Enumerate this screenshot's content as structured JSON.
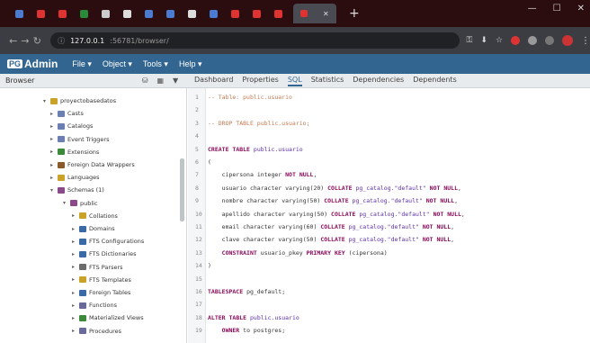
{
  "browser": {
    "address": "127.0.0.1",
    "address_path": ":56781/browser/"
  },
  "app": {
    "logo_prefix": "PG",
    "logo_text": "Admin",
    "menu": [
      "File ▾",
      "Object ▾",
      "Tools ▾",
      "Help ▾"
    ]
  },
  "panel": {
    "browser_label": "Browser",
    "tabs": [
      "Dashboard",
      "Properties",
      "SQL",
      "Statistics",
      "Dependencies",
      "Dependents"
    ],
    "active_tab": "SQL"
  },
  "tree": [
    {
      "label": "proyectobasedatos",
      "color": "#c9a227",
      "arrow": "▾"
    },
    {
      "label": "Casts",
      "color": "#6b7fb3",
      "arrow": "▸"
    },
    {
      "label": "Catalogs",
      "color": "#6b7fb3",
      "arrow": "▸"
    },
    {
      "label": "Event Triggers",
      "color": "#6b7fb3",
      "arrow": "▸"
    },
    {
      "label": "Extensions",
      "color": "#3a8a3a",
      "arrow": "▸"
    },
    {
      "label": "Foreign Data Wrappers",
      "color": "#8a5a2a",
      "arrow": "▸"
    },
    {
      "label": "Languages",
      "color": "#c9a227",
      "arrow": "▸"
    },
    {
      "label": "Schemas (1)",
      "color": "#8a4a8a",
      "arrow": "▾"
    },
    {
      "label": "public",
      "color": "#8a4a8a",
      "arrow": "▾"
    },
    {
      "label": "Collations",
      "color": "#c9a227",
      "arrow": "▸"
    },
    {
      "label": "Domains",
      "color": "#3a6aa6",
      "arrow": "▸"
    },
    {
      "label": "FTS Configurations",
      "color": "#3a6aa6",
      "arrow": "▸"
    },
    {
      "label": "FTS Dictionaries",
      "color": "#3a6aa6",
      "arrow": "▸"
    },
    {
      "label": "FTS Parsers",
      "color": "#6a6a6a",
      "arrow": "▸"
    },
    {
      "label": "FTS Templates",
      "color": "#c9a227",
      "arrow": "▸"
    },
    {
      "label": "Foreign Tables",
      "color": "#3a6aa6",
      "arrow": "▸"
    },
    {
      "label": "Functions",
      "color": "#6a6a9a",
      "arrow": "▸"
    },
    {
      "label": "Materialized Views",
      "color": "#3a8a3a",
      "arrow": "▸"
    },
    {
      "label": "Procedures",
      "color": "#6a6a9a",
      "arrow": "▸"
    }
  ],
  "sql": {
    "line_numbers": [
      "1",
      "2",
      "3",
      "4",
      "5",
      "6",
      "7",
      "8",
      "9",
      "10",
      "11",
      "12",
      "13",
      "14",
      "15",
      "16",
      "17",
      "18",
      "19"
    ],
    "lines": [
      "-- Table: public.usuario",
      "",
      "-- DROP TABLE public.usuario;",
      "",
      "CREATE TABLE public.usuario",
      "(",
      "    cipersona integer NOT NULL,",
      "    usuario character varying(20) COLLATE pg_catalog.\"default\" NOT NULL,",
      "    nombre character varying(50) COLLATE pg_catalog.\"default\" NOT NULL,",
      "    apellido character varying(50) COLLATE pg_catalog.\"default\" NOT NULL,",
      "    email character varying(60) COLLATE pg_catalog.\"default\" NOT NULL,",
      "    clave character varying(50) COLLATE pg_catalog.\"default\" NOT NULL,",
      "    CONSTRAINT usuario_pkey PRIMARY KEY (cipersona)",
      ")",
      "",
      "TABLESPACE pg_default;",
      "",
      "ALTER TABLE public.usuario",
      "    OWNER to postgres;"
    ]
  }
}
